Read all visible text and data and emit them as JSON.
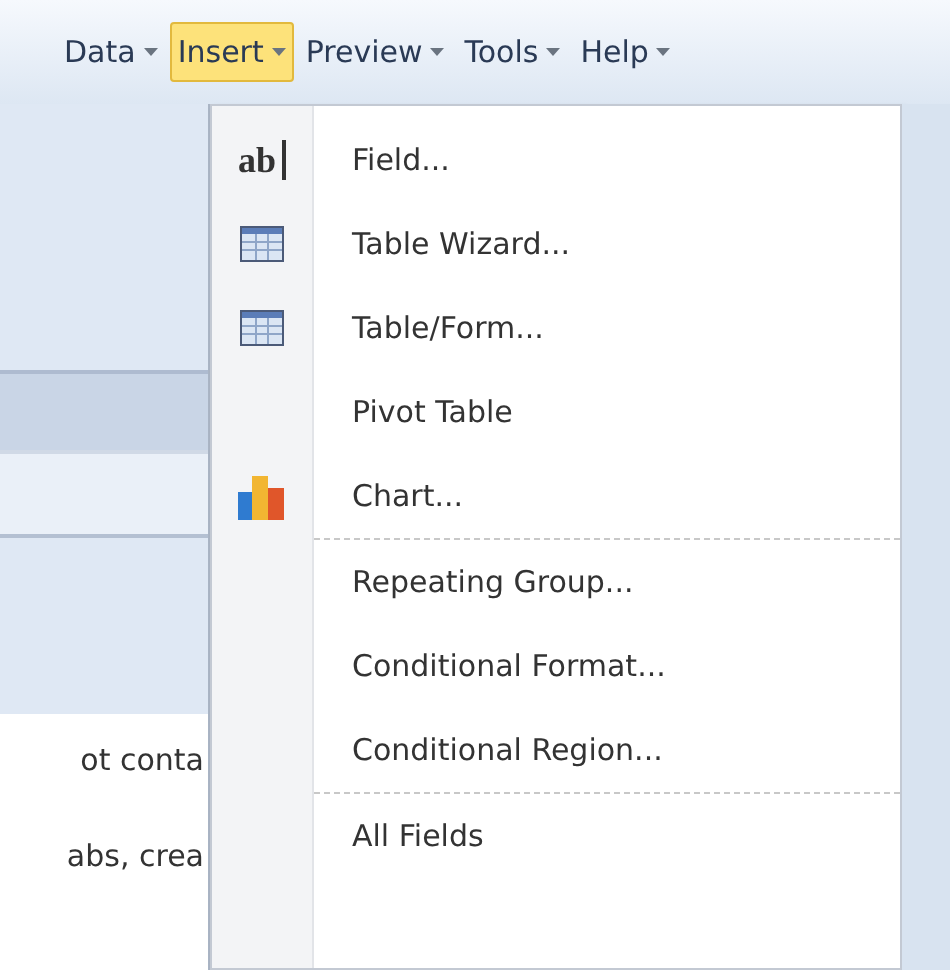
{
  "menubar": [
    {
      "label": "Data",
      "selected": false
    },
    {
      "label": "Insert",
      "selected": true
    },
    {
      "label": "Preview",
      "selected": false
    },
    {
      "label": "Tools",
      "selected": false
    },
    {
      "label": "Help",
      "selected": false
    }
  ],
  "insert_menu": [
    {
      "kind": "glyph",
      "icon_text": "ab",
      "label": "Field..."
    },
    {
      "kind": "table",
      "label": "Table Wizard..."
    },
    {
      "kind": "table",
      "label": "Table/Form..."
    },
    {
      "kind": "plain",
      "label": "Pivot Table"
    },
    {
      "kind": "chart",
      "label": "Chart..."
    },
    {
      "kind": "separator"
    },
    {
      "kind": "plain",
      "label": "Repeating Group..."
    },
    {
      "kind": "plain",
      "label": "Conditional Format..."
    },
    {
      "kind": "plain",
      "label": "Conditional Region..."
    },
    {
      "kind": "separator"
    },
    {
      "kind": "plain",
      "label": "All Fields"
    }
  ],
  "background_text": [
    "ot conta",
    "abs, crea"
  ]
}
